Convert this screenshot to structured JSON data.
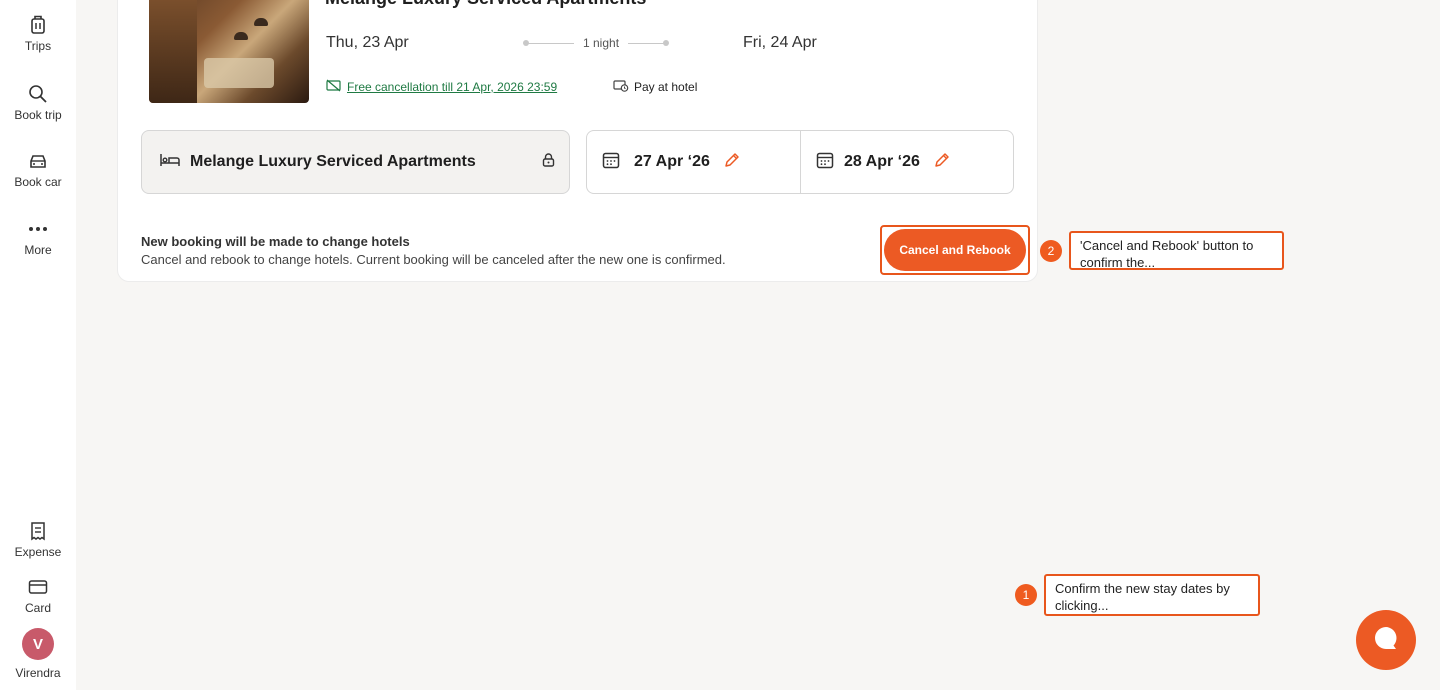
{
  "sidebar": {
    "items": [
      {
        "label": "Trips",
        "icon": "luggage-icon"
      },
      {
        "label": "Book trip",
        "icon": "search-icon"
      },
      {
        "label": "Book car",
        "icon": "car-icon"
      },
      {
        "label": "More",
        "icon": "more-dots-icon"
      }
    ],
    "bottom": [
      {
        "label": "Expense",
        "icon": "receipt-icon"
      },
      {
        "label": "Card",
        "icon": "credit-card-icon"
      }
    ],
    "user": {
      "initial": "V",
      "name": "Virendra"
    }
  },
  "booking": {
    "hotel_name_header": "Melange Luxury Serviced Apartments",
    "check_in": "Thu, 23 Apr",
    "check_out": "Fri, 24 Apr",
    "nights": "1 night",
    "free_cancellation": "Free cancellation till 21 Apr, 2026 23:59",
    "payment": "Pay at hotel"
  },
  "change": {
    "hotel_name": "Melange Luxury Serviced Apartments",
    "new_check_in": "27 Apr ‘26",
    "new_check_out": "28 Apr ‘26"
  },
  "notice": {
    "title": "New booking will be made to change hotels",
    "body": "Cancel and rebook to change hotels. Current booking will be canceled after the new one is confirmed."
  },
  "actions": {
    "cancel_rebook": "Cancel and Rebook"
  },
  "annotations": [
    {
      "step": "1",
      "text": "Confirm the new stay dates by clicking..."
    },
    {
      "step": "2",
      "text": "'Cancel and Rebook' button to confirm the..."
    }
  ],
  "colors": {
    "accent": "#ec5a24",
    "success": "#1f7a43",
    "avatar": "#c85a6a"
  }
}
